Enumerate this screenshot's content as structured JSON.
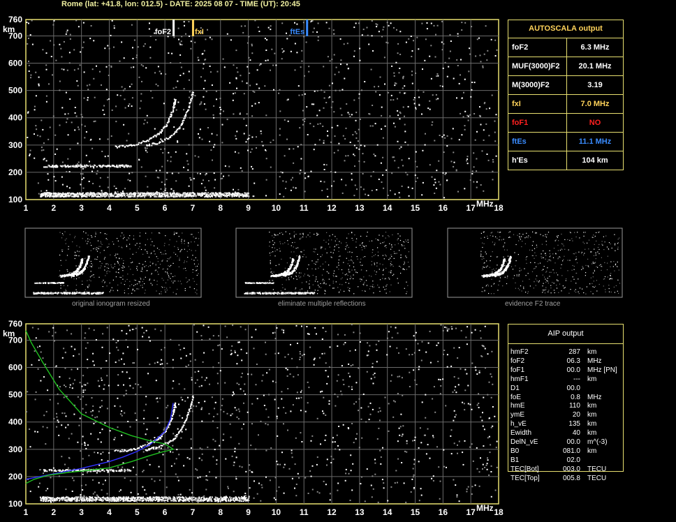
{
  "header": "Rome (lat: +41.8, lon: 012.5) - DATE: 2025 08 07 - TIME (UT): 20:45",
  "autoscala": {
    "title": "AUTOSCALA output",
    "rows": [
      {
        "key": "foF2",
        "value": "6.3 MHz",
        "color": "#ffffff"
      },
      {
        "key": "MUF(3000)F2",
        "value": "20.1 MHz",
        "color": "#ffffff"
      },
      {
        "key": "M(3000)F2",
        "value": "3.19",
        "color": "#ffffff"
      },
      {
        "key": "fxI",
        "value": "7.0 MHz",
        "color": "#ffd35a"
      },
      {
        "key": "foF1",
        "value": "NO",
        "color": "#ff2020"
      },
      {
        "key": "ftEs",
        "value": "11.1 MHz",
        "color": "#3a8cff"
      },
      {
        "key": "h'Es",
        "value": "104    km",
        "color": "#ffffff"
      }
    ]
  },
  "aip": {
    "title": "AIP output",
    "rows": [
      {
        "name": "hmF2",
        "value": "287",
        "unit": "km"
      },
      {
        "name": "foF2",
        "value": "06.3",
        "unit": "MHz"
      },
      {
        "name": "foF1",
        "value": "00.0",
        "unit": "MHz   [PN]"
      },
      {
        "name": "hmF1",
        "value": "---",
        "unit": "km"
      },
      {
        "name": "D1",
        "value": "00.0",
        "unit": ""
      },
      {
        "name": "foE",
        "value": "0.8",
        "unit": "MHz"
      },
      {
        "name": "hmE",
        "value": "110",
        "unit": "km"
      },
      {
        "name": "ymE",
        "value": "20",
        "unit": "km"
      },
      {
        "name": "h_vE",
        "value": "135",
        "unit": "km"
      },
      {
        "name": "Ewidth",
        "value": "40",
        "unit": "km"
      },
      {
        "name": "DelN_vE",
        "value": "00.0",
        "unit": "m^(-3)"
      },
      {
        "name": "B0",
        "value": "081.0",
        "unit": "km"
      },
      {
        "name": "B1",
        "value": "02.0",
        "unit": ""
      },
      {
        "name": "TEC[Bot]",
        "value": "003.0",
        "unit": "TECU"
      },
      {
        "name": "TEC[Top]",
        "value": "005.8",
        "unit": "TECU"
      }
    ]
  },
  "captions": [
    "original ionogram resized",
    "eliminate multiple reflections",
    "evidence F2 trace"
  ],
  "chart_data": [
    {
      "type": "scatter",
      "title": "",
      "xlabel": "MHz",
      "ylabel": "km",
      "xlim": [
        1,
        18
      ],
      "ylim": [
        100,
        760
      ],
      "xticks": [
        "1",
        "2",
        "3",
        "4",
        "5",
        "6",
        "7",
        "8",
        "9",
        "10",
        "11",
        "12",
        "13",
        "14",
        "15",
        "16",
        "17",
        "18"
      ],
      "yticks": [
        "100",
        "200",
        "300",
        "400",
        "500",
        "600",
        "700",
        "760"
      ],
      "grid": true,
      "markers": [
        {
          "label": "foF2",
          "x": 6.3,
          "color": "#ffffff"
        },
        {
          "label": "fxI",
          "x": 7.0,
          "color": "#ffd35a"
        },
        {
          "label": "ftEs",
          "x": 11.1,
          "color": "#3a8cff"
        }
      ],
      "traces": {
        "es_layer": {
          "x_range": [
            1.5,
            9.0
          ],
          "height": 120
        },
        "es_multiple": {
          "x_range": [
            1.6,
            4.8
          ],
          "height": 225
        },
        "f2_o_trace": [
          [
            4.2,
            296
          ],
          [
            4.8,
            300
          ],
          [
            5.4,
            320
          ],
          [
            5.8,
            345
          ],
          [
            6.1,
            385
          ],
          [
            6.3,
            440
          ],
          [
            6.35,
            470
          ]
        ],
        "f2_x_trace": [
          [
            5.3,
            300
          ],
          [
            5.8,
            312
          ],
          [
            6.3,
            340
          ],
          [
            6.6,
            380
          ],
          [
            6.85,
            440
          ],
          [
            7.0,
            500
          ]
        ]
      }
    },
    {
      "type": "line",
      "title": "",
      "xlabel": "MHz",
      "ylabel": "km",
      "xlim": [
        1,
        18
      ],
      "ylim": [
        100,
        760
      ],
      "grid": true,
      "series": [
        {
          "name": "",
          "color": "#3030ff",
          "x": [
            1,
            1.5,
            2,
            3,
            4,
            4.5,
            5,
            5.5,
            6,
            6.2,
            6.3
          ],
          "y": [
            190,
            200,
            210,
            230,
            255,
            272,
            292,
            320,
            365,
            410,
            470
          ]
        },
        {
          "name": "",
          "color": "#20c020",
          "x": [
            1,
            1.3,
            1.8,
            2.5,
            3.2,
            4,
            4.8,
            5.4,
            5.9,
            6.2,
            6.3,
            6.0,
            5.5,
            4.8,
            4.0,
            3.0,
            2.2,
            1.6,
            1.2,
            1.0
          ],
          "y": [
            175,
            190,
            205,
            215,
            222,
            232,
            255,
            275,
            290,
            297,
            300,
            320,
            330,
            350,
            380,
            430,
            520,
            620,
            690,
            735
          ]
        }
      ]
    }
  ]
}
